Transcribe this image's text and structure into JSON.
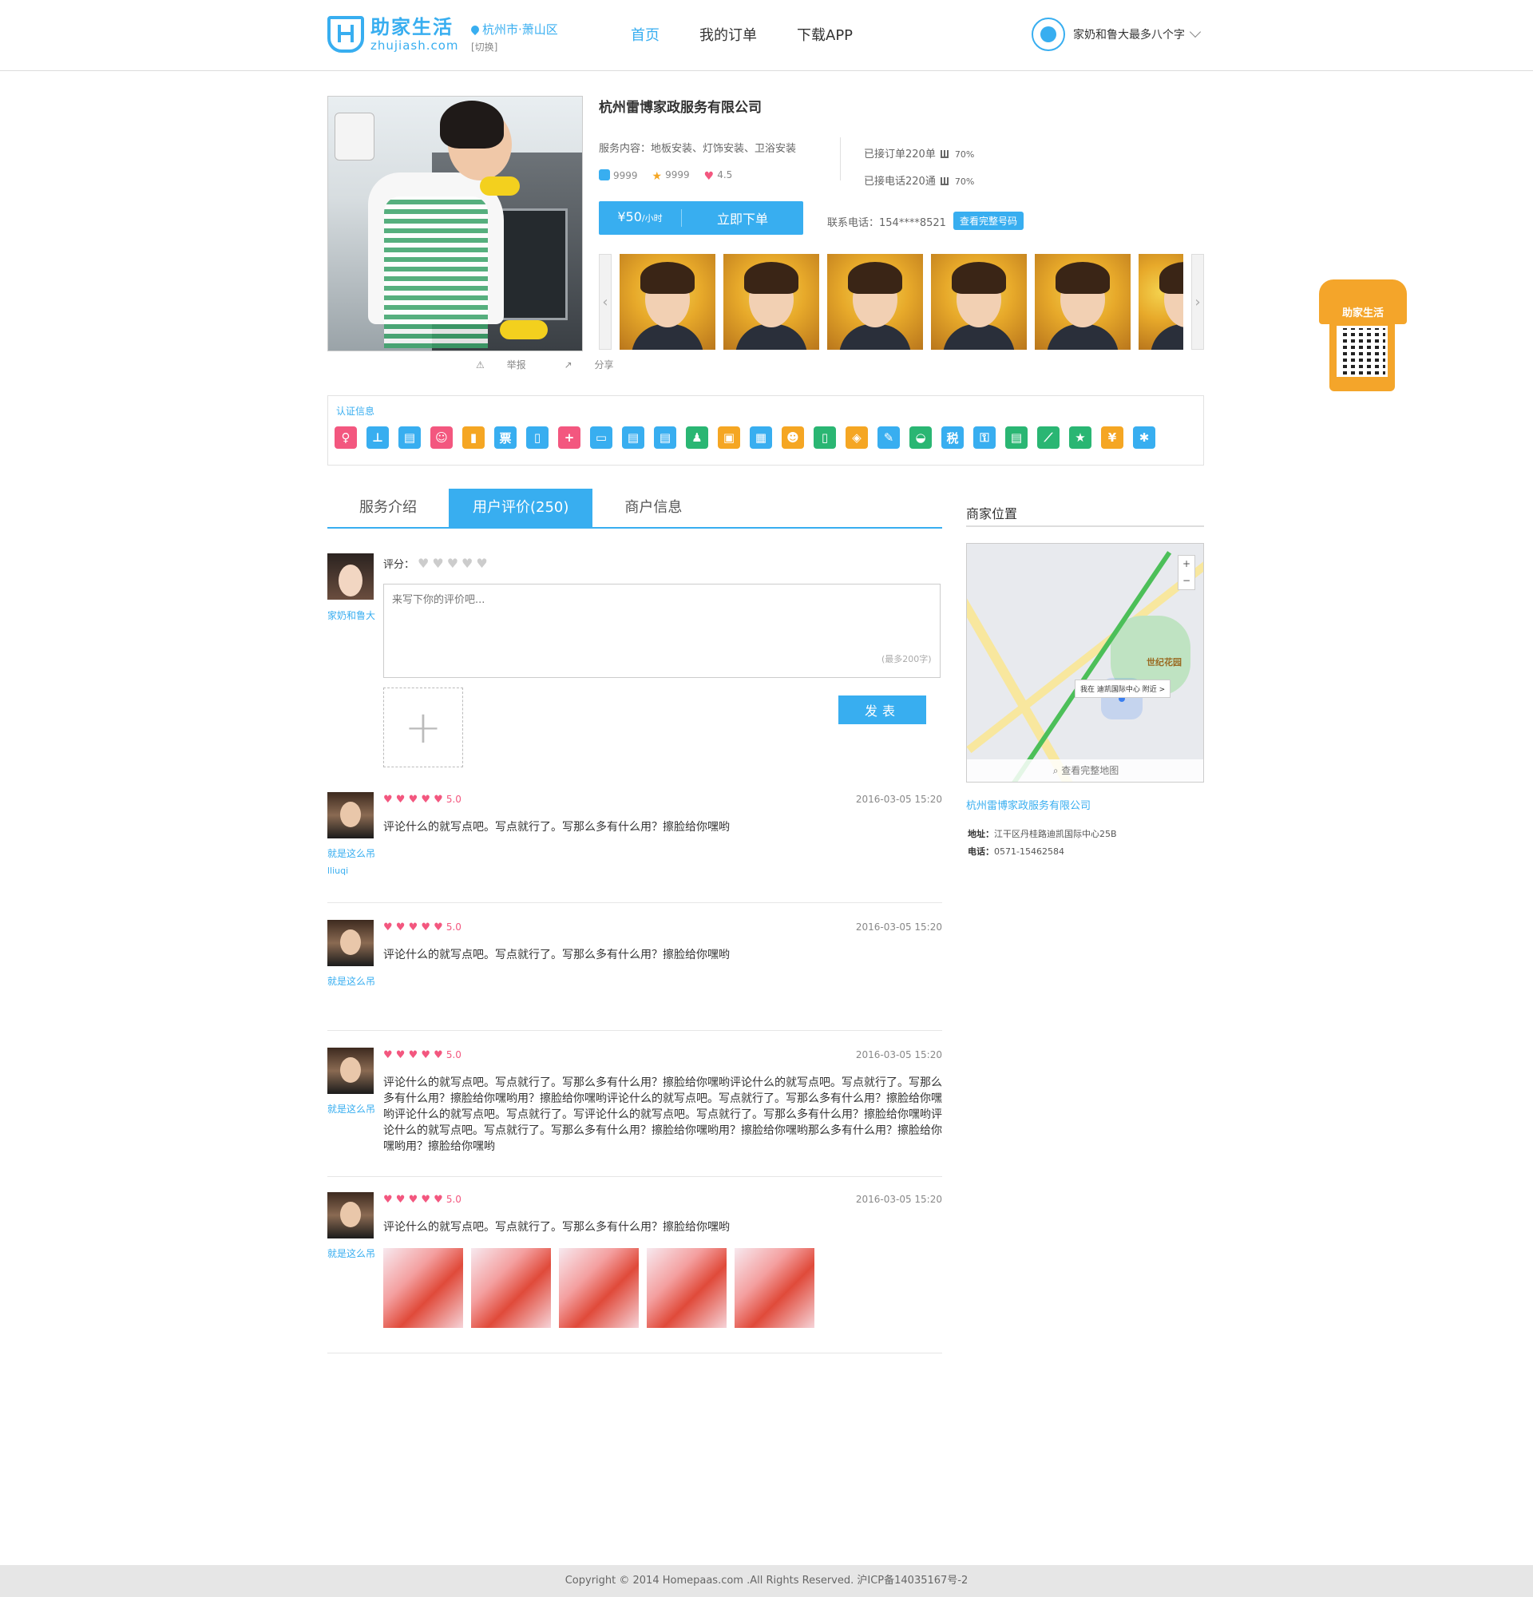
{
  "header": {
    "logo_cn": "助家生活",
    "logo_en": "zhujiash.com",
    "city": "杭州市·萧山区",
    "switch": "[切换]",
    "nav": [
      {
        "label": "首页",
        "active": true
      },
      {
        "label": "我的订单",
        "active": false
      },
      {
        "label": "下载APP",
        "active": false
      }
    ],
    "user_name": "家奶和鲁大最多八个字"
  },
  "provider": {
    "actions": {
      "report": "举报",
      "share": "分享"
    },
    "company": "杭州雷博家政服务有限公司",
    "service": "服务内容：地板安装、灯饰安装、卫浴安装",
    "stats": {
      "likes": "9999",
      "favorites": "9999",
      "rating": "4.5"
    },
    "orders": {
      "label": "已接订单220单",
      "rate": "70%"
    },
    "calls": {
      "label": "已接电话220通",
      "rate": "70%"
    },
    "price": {
      "amount": "¥50",
      "unit": "/小时"
    },
    "order_button": "立即下单",
    "phone": "联系电话：154****8521",
    "phone_button": "查看完整号码"
  },
  "auth": {
    "title": "认证信息",
    "icons": [
      {
        "name": "person-icon",
        "color": "#f3577f",
        "glyph": "♀"
      },
      {
        "name": "org-icon",
        "color": "#38aef0",
        "glyph": "⊥"
      },
      {
        "name": "id-card-icon",
        "color": "#38aef0",
        "glyph": "▤"
      },
      {
        "name": "baby-icon",
        "color": "#f3577f",
        "glyph": "☺"
      },
      {
        "name": "bottle-icon",
        "color": "#f5a623",
        "glyph": "▮"
      },
      {
        "name": "ticket-icon",
        "color": "#38aef0",
        "glyph": "票"
      },
      {
        "name": "phone-icon",
        "color": "#38aef0",
        "glyph": "▯"
      },
      {
        "name": "medical-icon",
        "color": "#f3577f",
        "glyph": "+"
      },
      {
        "name": "tv-icon",
        "color": "#38aef0",
        "glyph": "▭"
      },
      {
        "name": "card-icon",
        "color": "#38aef0",
        "glyph": "▤"
      },
      {
        "name": "card2-icon",
        "color": "#38aef0",
        "glyph": "▤"
      },
      {
        "name": "worker-icon",
        "color": "#2ab673",
        "glyph": "♟"
      },
      {
        "name": "box-icon",
        "color": "#f5a623",
        "glyph": "▣"
      },
      {
        "name": "briefcase-icon",
        "color": "#38aef0",
        "glyph": "▦"
      },
      {
        "name": "user-badge-icon",
        "color": "#f5a623",
        "glyph": "☻"
      },
      {
        "name": "tablet-icon",
        "color": "#2ab673",
        "glyph": "▯"
      },
      {
        "name": "code-icon",
        "color": "#f5a623",
        "glyph": "◈"
      },
      {
        "name": "wrench-icon",
        "color": "#38aef0",
        "glyph": "✎"
      },
      {
        "name": "bucket-icon",
        "color": "#2ab673",
        "glyph": "◒"
      },
      {
        "name": "tax-icon",
        "color": "#38aef0",
        "glyph": "税"
      },
      {
        "name": "lock-icon",
        "color": "#38aef0",
        "glyph": "⚿"
      },
      {
        "name": "license-icon",
        "color": "#2ab673",
        "glyph": "▤"
      },
      {
        "name": "chart-icon",
        "color": "#2ab673",
        "glyph": "⟋"
      },
      {
        "name": "star-badge-icon",
        "color": "#2ab673",
        "glyph": "★"
      },
      {
        "name": "money-icon",
        "color": "#f5a623",
        "glyph": "¥"
      },
      {
        "name": "settings-icon",
        "color": "#38aef0",
        "glyph": "✱"
      }
    ]
  },
  "tabs": [
    {
      "label": "服务介绍",
      "active": false
    },
    {
      "label": "用户评价(250)",
      "active": true
    },
    {
      "label": "商户信息",
      "active": false
    }
  ],
  "comment_form": {
    "user_name": "家奶和鲁大",
    "rating_label": "评分：",
    "placeholder": "来写下你的评价吧...",
    "limit": "(最多200字)",
    "post_button": "发表"
  },
  "reviews": [
    {
      "name": "就是这么吊",
      "sub": "lliuqi",
      "score": "5.0",
      "time": "2016-03-05 15:20",
      "text": "评论什么的就写点吧。写点就行了。写那么多有什么用？擦脸给你嘿哟",
      "images": 0
    },
    {
      "name": "就是这么吊",
      "sub": "",
      "score": "5.0",
      "time": "2016-03-05 15:20",
      "text": "评论什么的就写点吧。写点就行了。写那么多有什么用？擦脸给你嘿哟",
      "images": 0
    },
    {
      "name": "就是这么吊",
      "sub": "",
      "score": "5.0",
      "time": "2016-03-05 15:20",
      "text": "评论什么的就写点吧。写点就行了。写那么多有什么用？擦脸给你嘿哟评论什么的就写点吧。写点就行了。写那么多有什么用？擦脸给你嘿哟用？擦脸给你嘿哟评论什么的就写点吧。写点就行了。写那么多有什么用？擦脸给你嘿哟评论什么的就写点吧。写点就行了。写评论什么的就写点吧。写点就行了。写那么多有什么用？擦脸给你嘿哟评论什么的就写点吧。写点就行了。写那么多有什么用？擦脸给你嘿哟用？擦脸给你嘿哟那么多有什么用？擦脸给你嘿哟用？擦脸给你嘿哟",
      "images": 0
    },
    {
      "name": "就是这么吊",
      "sub": "",
      "score": "5.0",
      "time": "2016-03-05 15:20",
      "text": "评论什么的就写点吧。写点就行了。写那么多有什么用？擦脸给你嘿哟",
      "images": 5
    }
  ],
  "sidebar": {
    "title": "商家位置",
    "map_tip": "我在 迪凯国际中心 附近 >",
    "map_park": "世纪花园",
    "map_full": "查看完整地图",
    "company": "杭州雷博家政服务有限公司",
    "address_label": "地址：",
    "address": "江干区丹桂路迪凯国际中心25B",
    "tel_label": "电话：",
    "tel": "0571-15462584"
  },
  "qr_badge": {
    "label": "助家生活"
  },
  "footer": {
    "text": "Copyright © 2014 Homepaas.com .All Rights Reserved. 沪ICP备14035167号-2"
  },
  "colors": {
    "accent": "#38aef0",
    "heart": "#f3577f",
    "orange": "#f5a623",
    "green": "#2ab673"
  }
}
